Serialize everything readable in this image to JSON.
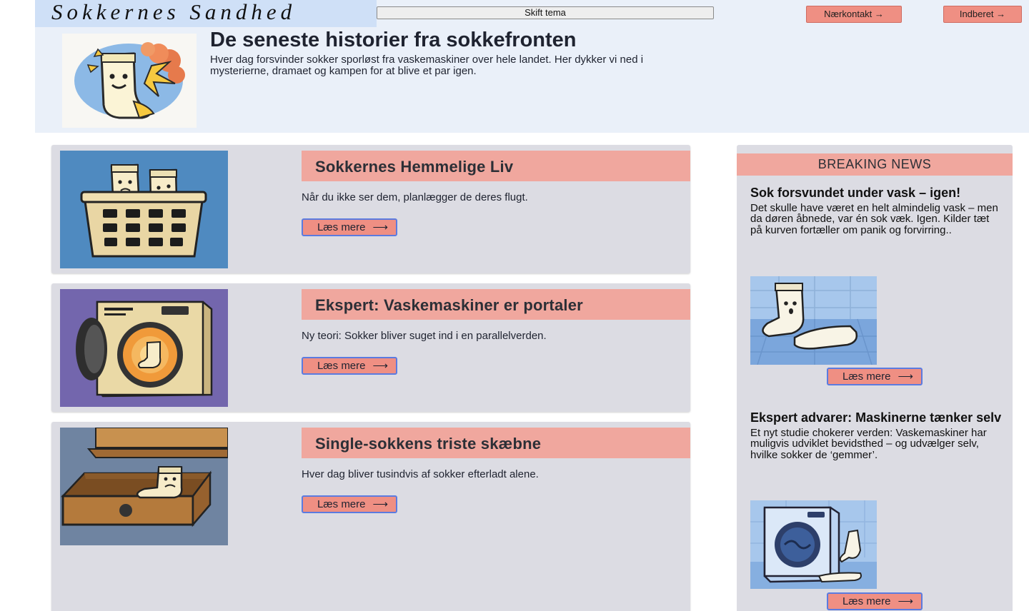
{
  "header": {
    "logo": "Sokkernes Sandhed",
    "theme_button": "Skift tema",
    "contact_button": "Nærkontakt →",
    "report_button": "Indberet →"
  },
  "hero": {
    "title": "De seneste historier fra sokkefronten",
    "description": "Hver dag forsvinder sokker sporløst fra vaskemaskiner over hele landet. Her dykker vi ned i mysterierne, dramaet og kampen for at blive et par igen."
  },
  "articles": [
    {
      "title": "Sokkernes Hemmelige Liv",
      "description": "Når du ikke ser dem, planlægger de deres flugt.",
      "read_more": "Læs mere",
      "image_bg": "#4f8ac0"
    },
    {
      "title": "Ekspert: Vaskemaskiner er portaler",
      "description": "Ny teori: Sokker bliver suget ind i en parallelverden.",
      "read_more": "Læs mere",
      "image_bg": "#7366ad"
    },
    {
      "title": "Single-sokkens triste skæbne",
      "description": "Hver dag bliver tusindvis af sokker efterladt alene.",
      "read_more": "Læs mere",
      "image_bg": "#6f84a1"
    }
  ],
  "sidebar": {
    "heading": "BREAKING NEWS",
    "items": [
      {
        "title": "Sok forsvundet under vask – igen!",
        "description": "Det skulle have været en helt almindelig vask – men da døren åbnede, var én sok væk. Igen. Kilder tæt på kurven fortæller om panik og forvirring..",
        "read_more": "Læs mere"
      },
      {
        "title": "Ekspert advarer: Maskinerne tænker selv",
        "description": "Et nyt studie chokerer verden: Vaskemaskiner har muligvis udviklet bevidsthed – og udvælger selv, hvilke sokker de ‘gemmer’.",
        "read_more": "Læs mere"
      }
    ]
  },
  "colors": {
    "header_bg": "#eaf0f9",
    "accent_salmon": "#f0a79e",
    "button_salmon": "#ef8f83",
    "card_bg": "#dcdce3",
    "button_border": "#5b7be0"
  }
}
